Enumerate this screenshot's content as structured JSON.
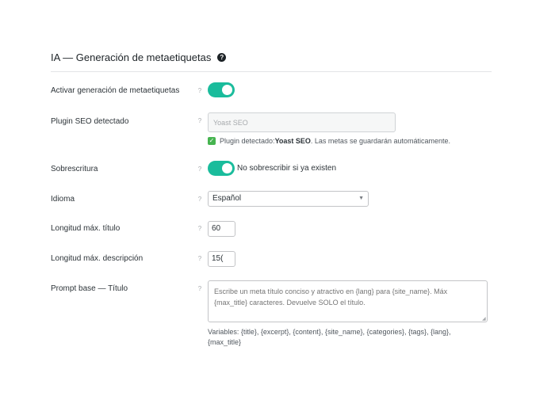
{
  "section": {
    "title": "IA — Generación de metaetiquetas",
    "help_icon": "question-circle-icon"
  },
  "help_mark": "?",
  "rows": {
    "enable": {
      "label": "Activar generación de metaetiquetas",
      "toggle_on": true
    },
    "seo_plugin": {
      "label": "Plugin SEO detectado",
      "value": "Yoast SEO",
      "note_prefix": "Plugin detectado: ",
      "note_plugin": "Yoast SEO",
      "note_suffix": ". Las metas se guardarán automáticamente.",
      "check_icon": "checkbox-checked-icon",
      "check_glyph": "✓"
    },
    "overwrite": {
      "label": "Sobrescritura",
      "toggle_on": true,
      "toggle_label": "No sobrescribir si ya existen"
    },
    "language": {
      "label": "Idioma",
      "selected": "Español",
      "caret": "▼"
    },
    "title_len": {
      "label": "Longitud máx. título",
      "value": "60"
    },
    "desc_len": {
      "label": "Longitud máx. descripción",
      "value": "15("
    },
    "prompt_title": {
      "label": "Prompt base — Título",
      "placeholder": "Escribe un meta título conciso y atractivo en {lang} para {site_name}. Máx {max_title} caracteres. Devuelve SOLO el título.",
      "variables": "Variables: {title}, {excerpt}, {content}, {site_name}, {categories}, {tags}, {lang}, {max_title}"
    }
  },
  "colors": {
    "accent": "#1abc9c",
    "check": "#46b450"
  }
}
